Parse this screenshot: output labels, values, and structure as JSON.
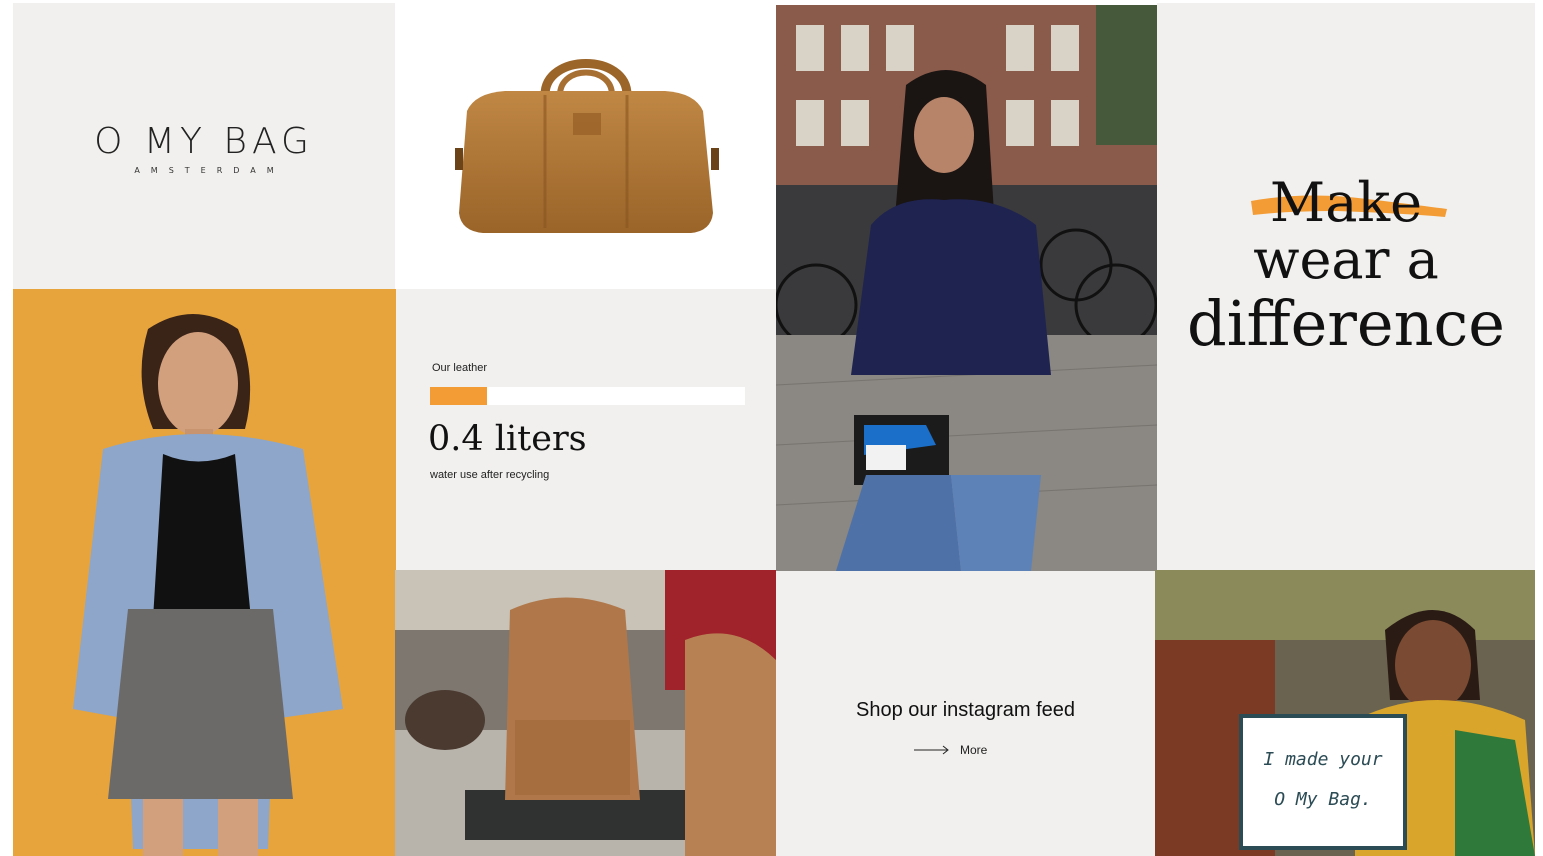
{
  "brand": {
    "name": "O MY BAG",
    "city": "AMSTERDAM"
  },
  "slogan": {
    "struck_word": "Make",
    "line2": "wear a",
    "line3": "difference",
    "accent_color": "#f39c36"
  },
  "stats": {
    "label": "Our leather",
    "progress_fraction": 0.18,
    "value": "0.4 liters",
    "caption": "water use after recycling",
    "bar_color": "#f39c36"
  },
  "instagram": {
    "title": "Shop our instagram feed",
    "more_label": "More",
    "more_icon": "arrow-right-icon"
  },
  "artisan": {
    "sign_line1": "I made your",
    "sign_line2": "O My Bag."
  }
}
